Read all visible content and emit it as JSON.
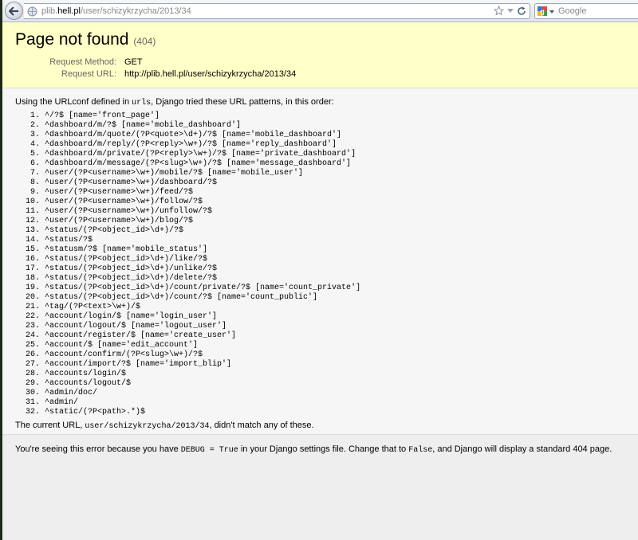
{
  "browser": {
    "url_prefix": "plib.",
    "url_domain": "hell.pl",
    "url_path": "/user/schizykrzycha/2013/34",
    "search_placeholder": "Google"
  },
  "page": {
    "title": "Page not found",
    "status_code": "(404)",
    "request_method_label": "Request Method:",
    "request_method": "GET",
    "request_url_label": "Request URL:",
    "request_url": "http://plib.hell.pl/user/schizykrzycha/2013/34",
    "intro_before": "Using the URLconf defined in ",
    "intro_code": "urls",
    "intro_after": ", Django tried these URL patterns, in this order:",
    "patterns": [
      "^/?$ [name='front_page']",
      "^dashboard/m/?$ [name='mobile_dashboard']",
      "^dashboard/m/quote/(?P<quote>\\d+)/?$ [name='mobile_dashboard']",
      "^dashboard/m/reply/(?P<reply>\\w+)/?$ [name='reply_dashboard']",
      "^dashboard/m/private/(?P<reply>\\w+)/?$ [name='private_dashboard']",
      "^dashboard/m/message/(?P<slug>\\w+)/?$ [name='message_dashboard']",
      "^user/(?P<username>\\w+)/mobile/?$ [name='mobile_user']",
      "^user/(?P<username>\\w+)/dashboard/?$",
      "^user/(?P<username>\\w+)/feed/?$",
      "^user/(?P<username>\\w+)/follow/?$",
      "^user/(?P<username>\\w+)/unfollow/?$",
      "^user/(?P<username>\\w+)/blog/?$",
      "^status/(?P<object_id>\\d+)/?$",
      "^status/?$",
      "^statusm/?$ [name='mobile_status']",
      "^status/(?P<object_id>\\d+)/like/?$",
      "^status/(?P<object_id>\\d+)/unlike/?$",
      "^status/(?P<object_id>\\d+)/delete/?$",
      "^status/(?P<object_id>\\d+)/count/private/?$ [name='count_private']",
      "^status/(?P<object_id>\\d+)/count/?$ [name='count_public']",
      "^tag/(?P<text>\\w+)/$",
      "^account/login/$ [name='login_user']",
      "^account/logout/$ [name='logout_user']",
      "^account/register/$ [name='create_user']",
      "^account/$ [name='edit_account']",
      "^account/confirm/(?P<slug>\\w+)/?$",
      "^account/import/?$ [name='import_blip']",
      "^accounts/login/$",
      "^accounts/logout/$",
      "^admin/doc/",
      "^admin/",
      "^static/(?P<path>.*)$"
    ],
    "current_before": "The current URL, ",
    "current_code": "user/schizykrzycha/2013/34",
    "current_after": ", didn't match any of these.",
    "expl_1": "You're seeing this error because you have ",
    "expl_code_1": "DEBUG = True",
    "expl_2": " in your Django settings file. Change that to ",
    "expl_code_2": "False",
    "expl_3": ", and Django will display a standard 404 page."
  }
}
